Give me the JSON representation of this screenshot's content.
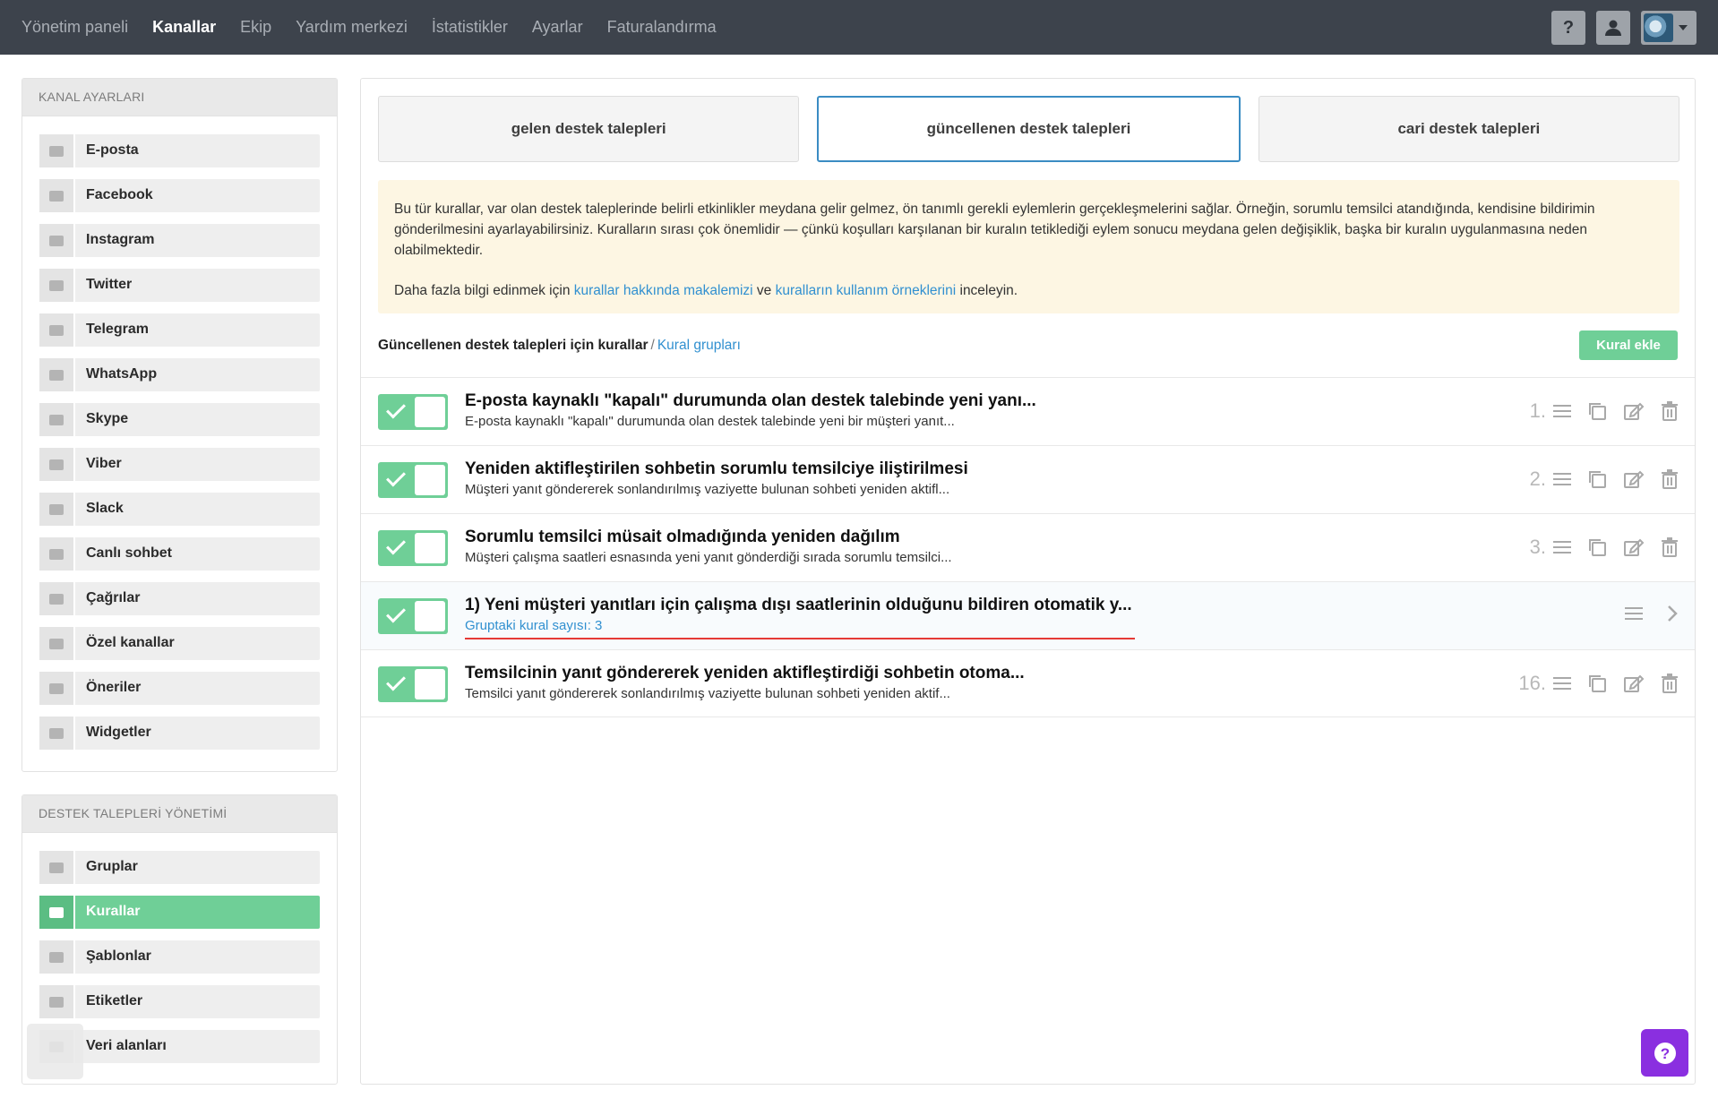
{
  "topnav": {
    "items": [
      "Yönetim paneli",
      "Kanallar",
      "Ekip",
      "Yardım merkezi",
      "İstatistikler",
      "Ayarlar",
      "Faturalandırma"
    ],
    "active_index": 1,
    "help_label": "?"
  },
  "sidebar": {
    "channels_header": "KANAL AYARLARI",
    "channels": [
      "E-posta",
      "Facebook",
      "Instagram",
      "Twitter",
      "Telegram",
      "WhatsApp",
      "Skype",
      "Viber",
      "Slack",
      "Canlı sohbet",
      "Çağrılar",
      "Özel kanallar",
      "Öneriler",
      "Widgetler"
    ],
    "channel_icons": [
      "envelope-icon",
      "facebook-icon",
      "instagram-icon",
      "twitter-icon",
      "telegram-icon",
      "whatsapp-icon",
      "skype-icon",
      "viber-icon",
      "slack-icon",
      "chat-icon",
      "phone-icon",
      "plus-circle-icon",
      "megaphone-icon",
      "cube-icon"
    ],
    "mgmt_header": "DESTEK TALEPLERİ YÖNETİMİ",
    "mgmt": [
      "Gruplar",
      "Kurallar",
      "Şablonlar",
      "Etiketler",
      "Veri alanları"
    ],
    "mgmt_icons": [
      "sitemap-icon",
      "shuffle-icon",
      "magic-icon",
      "tags-icon",
      "fields-icon"
    ],
    "mgmt_active_index": 1
  },
  "tabs": [
    "gelen destek talepleri",
    "güncellenen destek talepleri",
    "cari destek talepleri"
  ],
  "active_tab": 1,
  "info": {
    "text1": "Bu tür kurallar, var olan destek taleplerinde belirli etkinlikler meydana gelir gelmez, ön tanımlı gerekli eylemlerin gerçekleşmelerini sağlar. Örneğin, sorumlu temsilci atandığında, kendisine bildirimin gönderilmesini ayarlayabilirsiniz. Kuralların sırası çok önemlidir — çünkü koşulları karşılanan bir kuralın tetiklediği eylem sonucu meydana gelen değişiklik, başka bir kuralın uygulanmasına neden olabilmektedir.",
    "text2_a": "Daha fazla bilgi edinmek için ",
    "link1": "kurallar hakkında makalemizi",
    "text2_b": " ve ",
    "link2": "kuralların kullanım örneklerini",
    "text2_c": " inceleyin."
  },
  "breadcrumb": {
    "current": "Güncellenen destek talepleri için kurallar",
    "separator": "/",
    "link": "Kural grupları"
  },
  "add_button": "Kural ekle",
  "rules": [
    {
      "number": "1.",
      "title": "E-posta kaynaklı \"kapalı\" durumunda olan destek talebinde yeni yanı...",
      "desc": "E-posta kaynaklı \"kapalı\" durumunda olan destek talebinde yeni bir müşteri yanıt...",
      "enabled": true
    },
    {
      "number": "2.",
      "title": "Yeniden aktifleştirilen sohbetin sorumlu temsilciye iliştirilmesi",
      "desc": "Müşteri yanıt göndererek sonlandırılmış vaziyette bulunan sohbeti yeniden aktifl...",
      "enabled": true
    },
    {
      "number": "3.",
      "title": "Sorumlu temsilci müsait olmadığında yeniden dağılım",
      "desc": "Müşteri çalışma saatleri esnasında yeni yanıt gönderdiği sırada sorumlu temsilci...",
      "enabled": true
    },
    {
      "number": "",
      "title": "1) Yeni müşteri yanıtları için çalışma dışı saatlerinin olduğunu bildiren otomatik y...",
      "desc": "Gruptaki kural sayısı: 3",
      "enabled": true,
      "is_group": true
    },
    {
      "number": "16.",
      "title": "Temsilcinin yanıt göndererek yeniden aktifleştirdiği sohbetin otoma...",
      "desc": "Temsilci yanıt göndererek sonlandırılmış vaziyette bulunan sohbeti yeniden aktif...",
      "enabled": true
    }
  ],
  "colors": {
    "accent_green": "#6fcf97",
    "link_blue": "#3190d0",
    "nav_bg": "#3d434c",
    "help_purple": "#8a2fe0"
  }
}
